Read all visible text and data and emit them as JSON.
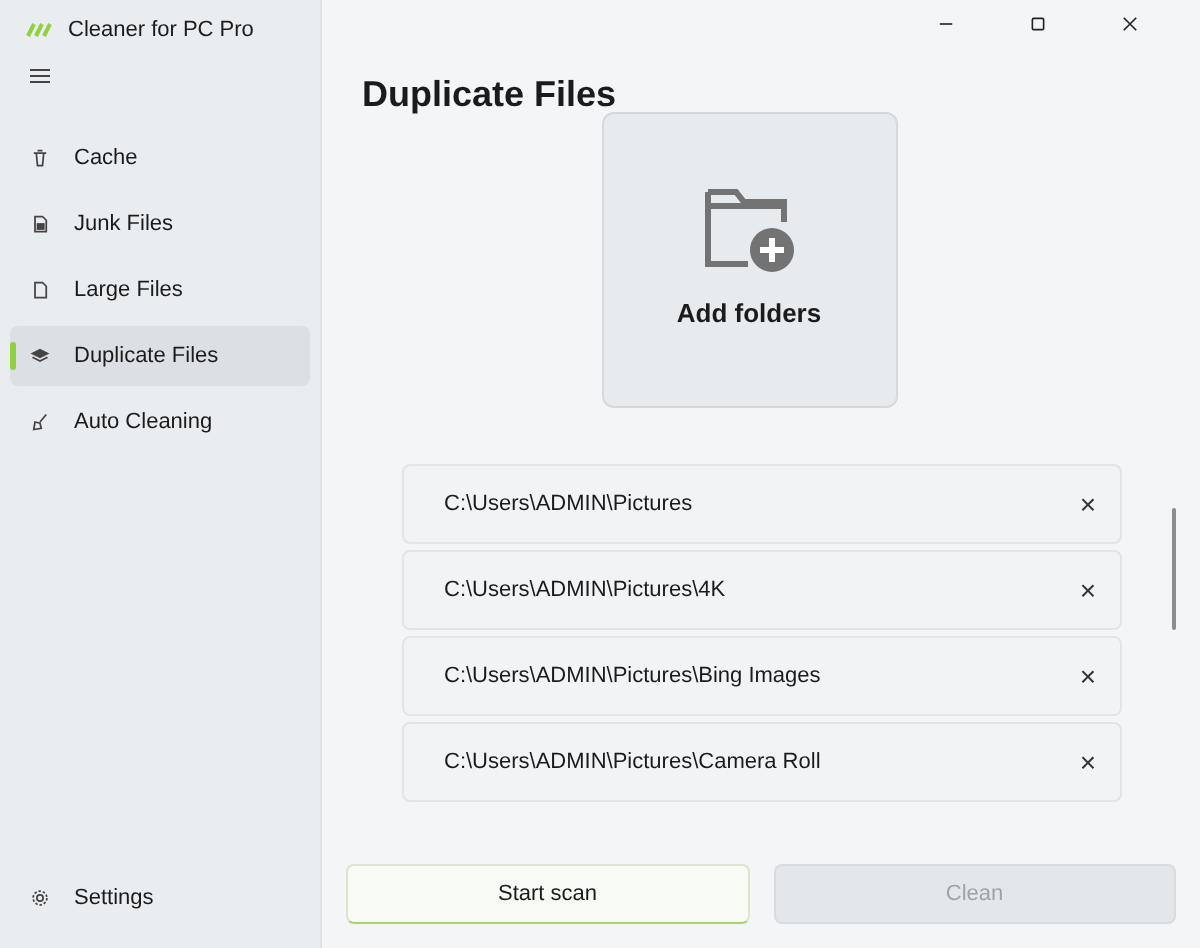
{
  "app": {
    "title": "Cleaner for PC Pro"
  },
  "window_controls": [
    {
      "kind": "minimize"
    },
    {
      "kind": "maximize"
    },
    {
      "kind": "close"
    }
  ],
  "sidebar": {
    "items": [
      {
        "label": "Cache",
        "kind": "trash",
        "selected": false
      },
      {
        "label": "Junk Files",
        "kind": "junk",
        "selected": false
      },
      {
        "label": "Large Files",
        "kind": "file",
        "selected": false
      },
      {
        "label": "Duplicate Files",
        "kind": "layers",
        "selected": true
      },
      {
        "label": "Auto Cleaning",
        "kind": "broom",
        "selected": false
      }
    ],
    "footer": {
      "label": "Settings",
      "kind": "gear"
    }
  },
  "page": {
    "title": "Duplicate Files",
    "add_button": {
      "label": "Add folders"
    },
    "folders": [
      {
        "path": "C:\\Users\\ADMIN\\Pictures",
        "remove": "×"
      },
      {
        "path": "C:\\Users\\ADMIN\\Pictures\\4K",
        "remove": "×"
      },
      {
        "path": "C:\\Users\\ADMIN\\Pictures\\Bing Images",
        "remove": "×"
      },
      {
        "path": "C:\\Users\\ADMIN\\Pictures\\Camera Roll",
        "remove": "×"
      }
    ],
    "buttons": [
      {
        "label": "Start scan",
        "disabled": false
      },
      {
        "label": "Clean",
        "disabled": true
      }
    ]
  }
}
